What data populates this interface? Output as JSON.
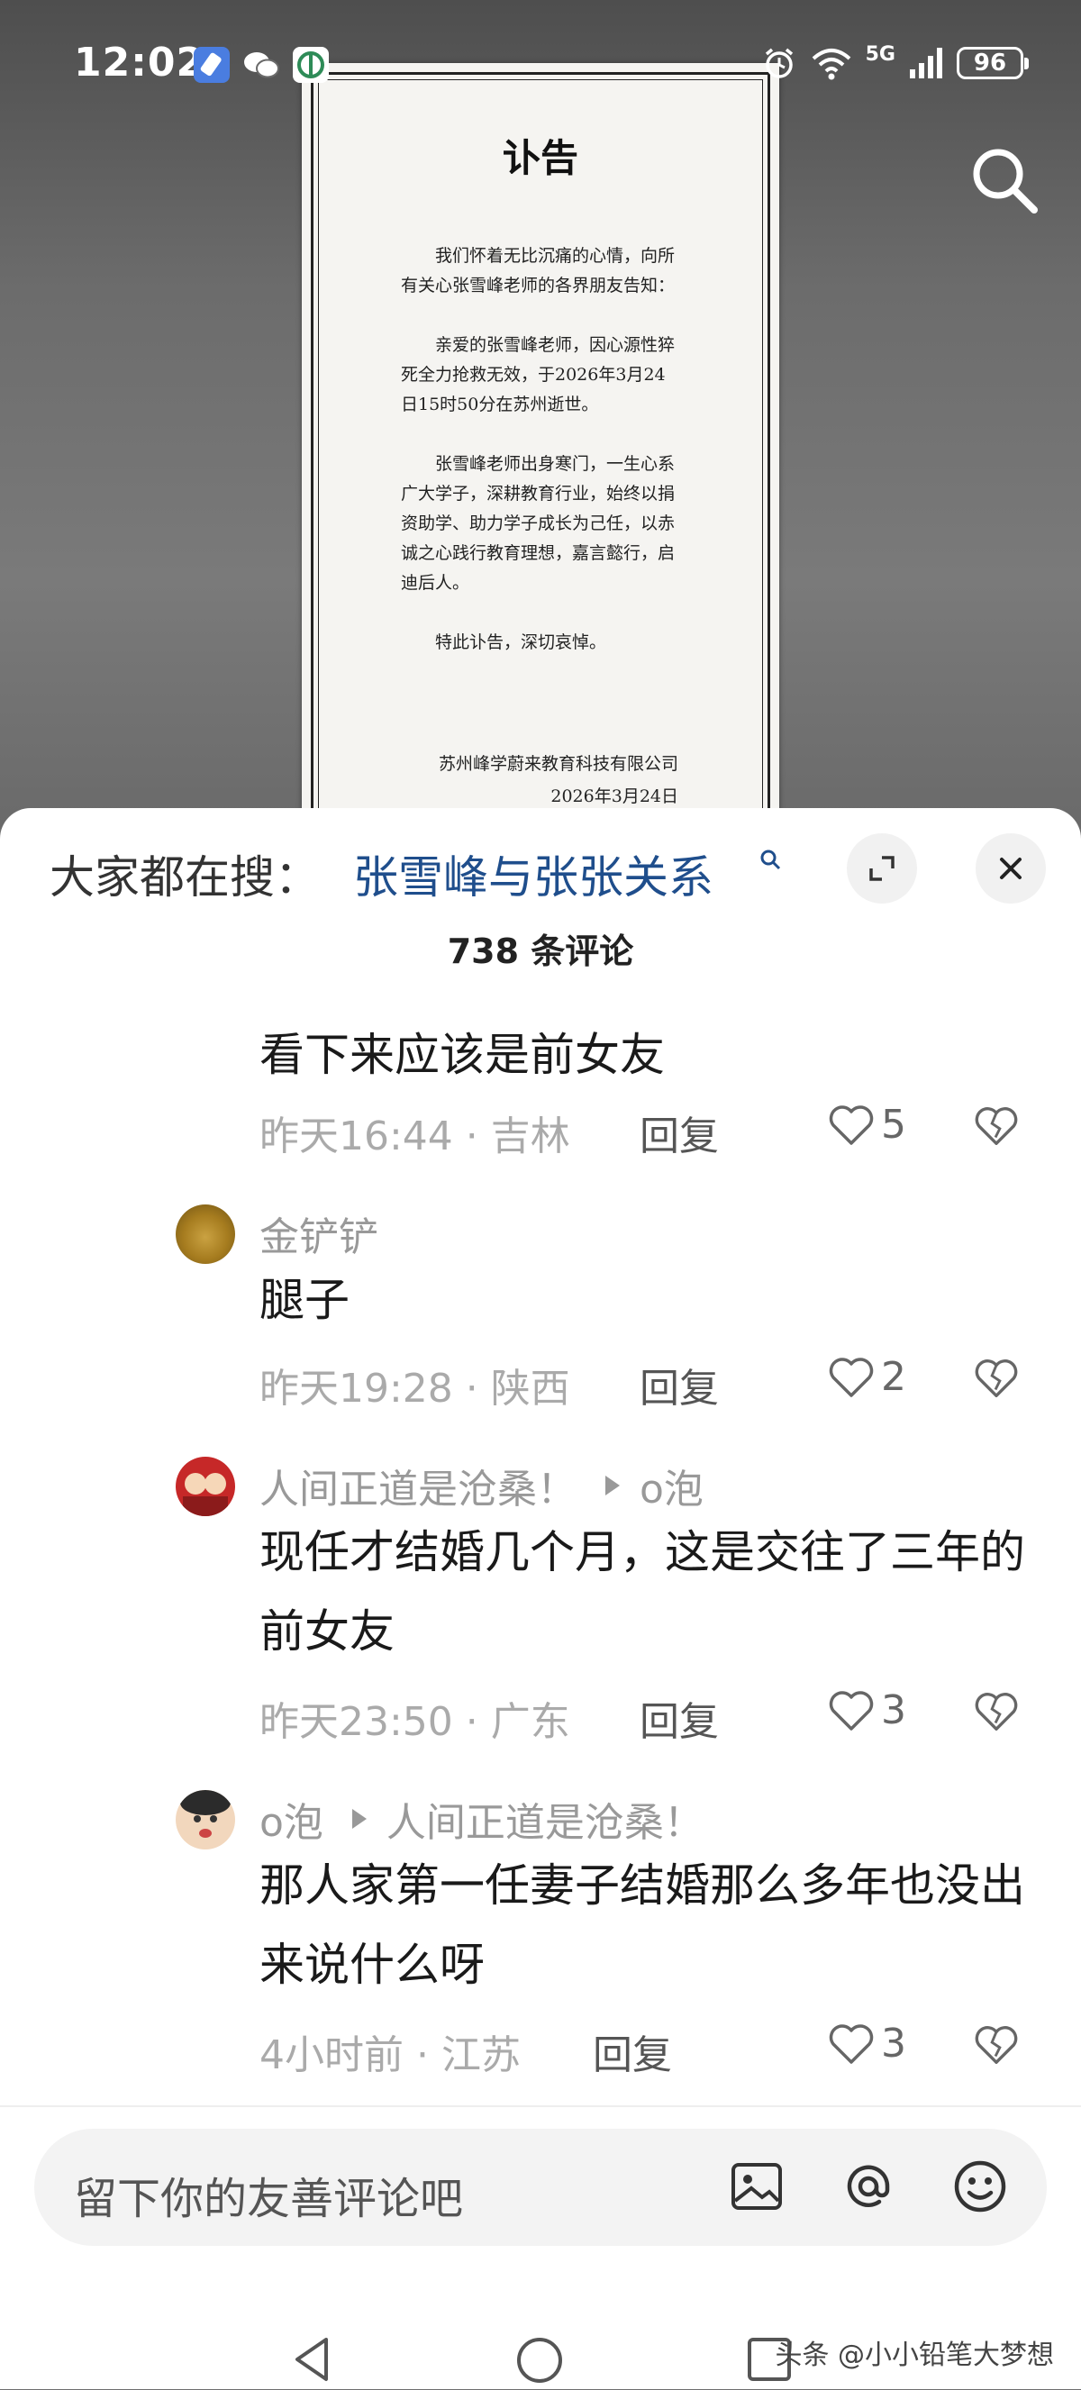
{
  "status": {
    "time": "12:02",
    "network": "5G",
    "battery": "96"
  },
  "notice": {
    "title": "讣告",
    "paragraphs": [
      "我们怀着无比沉痛的心情，向所有关心张雪峰老师的各界朋友告知：",
      "亲爱的张雪峰老师，因心源性猝死全力抢救无效，于2026年3月24日15时50分在苏州逝世。",
      "张雪峰老师出身寒门，一生心系广大学子，深耕教育行业，始终以捐资助学、助力学子成长为己任，以赤诚之心践行教育理想，嘉言懿行，启迪后人。",
      "特此讣告，深切哀悼。"
    ],
    "org": "苏州峰学蔚来教育科技有限公司",
    "date": "2026年3月24日"
  },
  "sheet": {
    "hot_label": "大家都在搜：",
    "hot_term": "张雪峰与张张关系",
    "comment_count": "738 条评论"
  },
  "comments": [
    {
      "author": "",
      "text": "看下来应该是前女友",
      "time": "昨天16:44",
      "location": "吉林",
      "reply_label": "回复",
      "likes": "5"
    },
    {
      "author": "金铲铲",
      "text": "腿子",
      "time": "昨天19:28",
      "location": "陕西",
      "reply_label": "回复",
      "likes": "2"
    },
    {
      "author": "人间正道是沧桑！",
      "reply_to": "o泡",
      "text": "现任才结婚几个月，这是交往了三年的前女友",
      "time": "昨天23:50",
      "location": "广东",
      "reply_label": "回复",
      "likes": "3"
    },
    {
      "author": "o泡",
      "reply_to": "人间正道是沧桑！",
      "text": "那人家第一任妻子结婚那么多年也没出来说什么呀",
      "time": "4小时前",
      "location": "江苏",
      "reply_label": "回复",
      "likes": "3"
    }
  ],
  "input": {
    "placeholder": "留下你的友善评论吧"
  },
  "watermark": "头条 @小小铅笔大梦想",
  "colors": {
    "link_blue": "#1f4e8c",
    "meta_gray": "#aaaaaa"
  },
  "icons": [
    "search-icon",
    "expand-icon",
    "close-icon",
    "heart-icon",
    "broken-heart-icon",
    "image-icon",
    "at-icon",
    "emoji-icon",
    "back-icon",
    "home-icon",
    "recents-icon"
  ]
}
